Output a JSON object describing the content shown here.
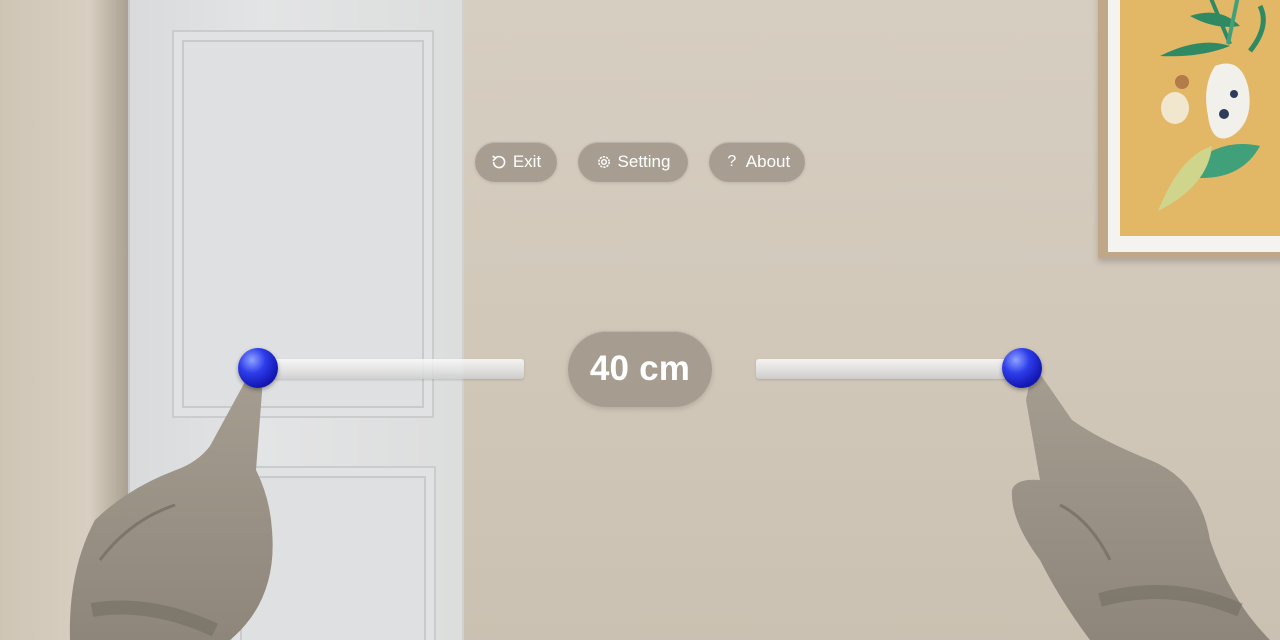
{
  "menu": {
    "exit": {
      "label": "Exit",
      "icon": "undo-icon"
    },
    "setting": {
      "label": "Setting",
      "icon": "gear-icon"
    },
    "about": {
      "label": "About",
      "icon": "question-icon"
    }
  },
  "measurement": {
    "distance_label": "40 cm",
    "anchor_color": "#2d3dea"
  },
  "colors": {
    "pill_background": "#968c80",
    "text": "#ffffff"
  }
}
